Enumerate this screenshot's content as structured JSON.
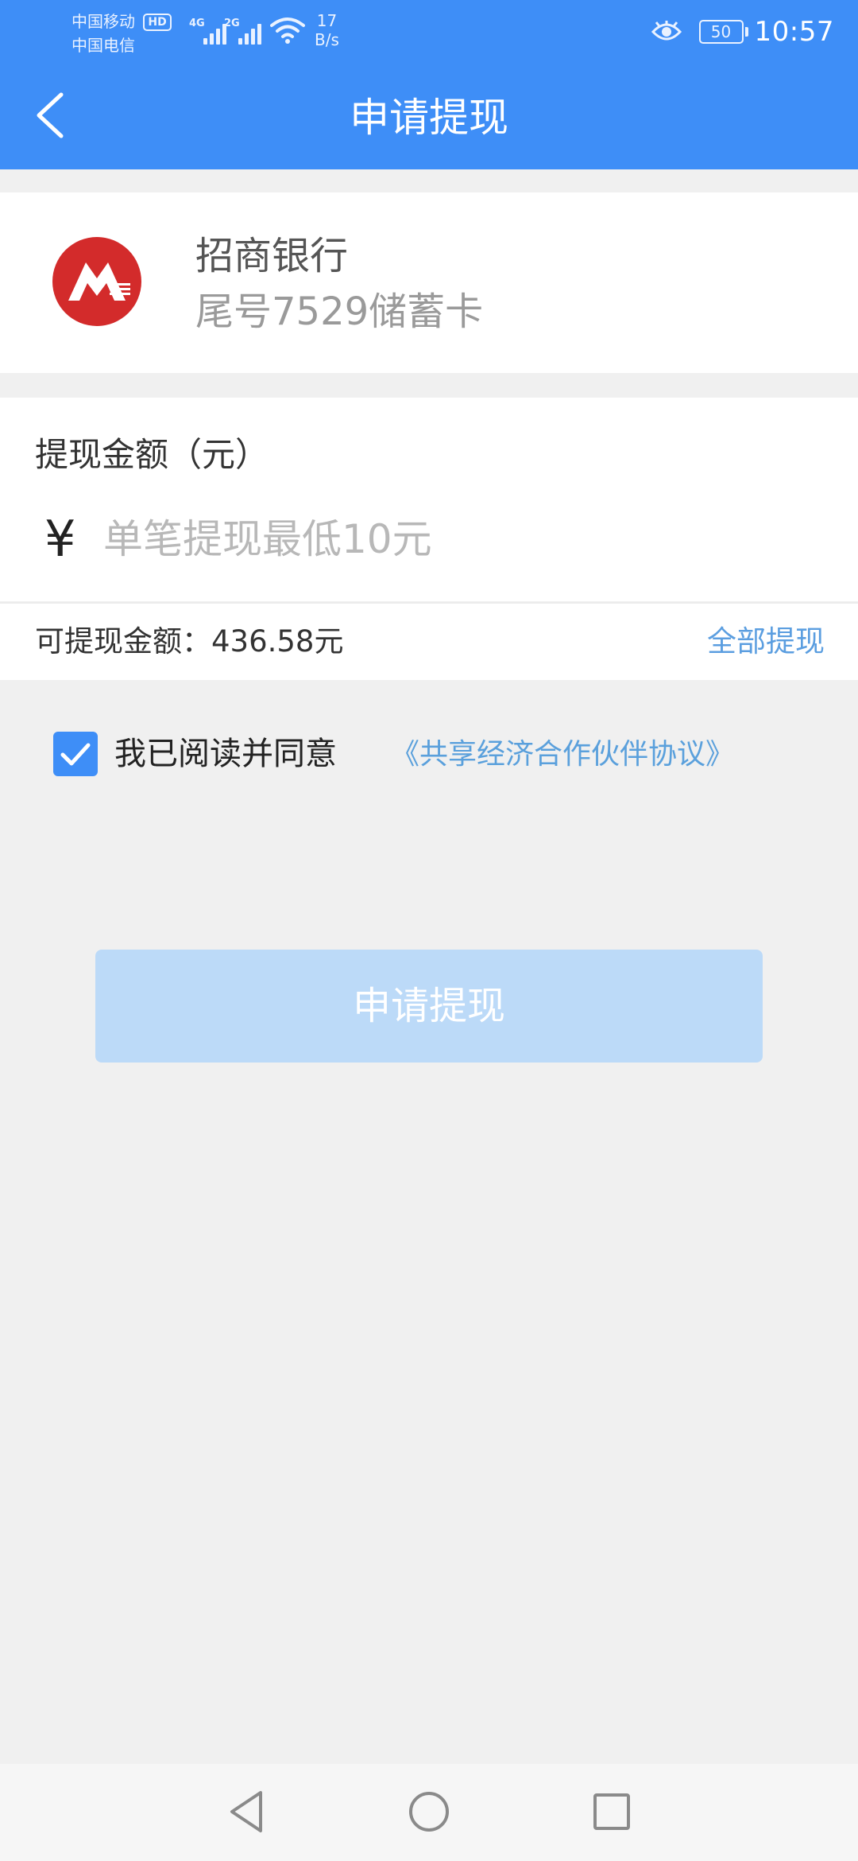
{
  "colors": {
    "primary": "#3e8ef7",
    "link": "#5aa0dc",
    "button_disabled": "#bcdaf8",
    "background": "#f0f0f0",
    "bank_logo_red": "#d32b2b"
  },
  "status_bar": {
    "carrier_1": "中国移动",
    "hd_badge": "HD",
    "carrier_2": "中国电信",
    "sim1_gen": "4G",
    "sim2_gen": "2G",
    "net_speed_value": "17",
    "net_speed_unit": "B/s",
    "battery": "50",
    "time": "10:57",
    "icons": [
      "signal-icon",
      "wifi-icon",
      "eye-icon",
      "battery-icon"
    ]
  },
  "header": {
    "title": "申请提现",
    "back_icon": "chevron-left-icon"
  },
  "bank_card": {
    "logo_icon": "cmb-bank-logo-icon",
    "bank_name": "招商银行",
    "card_desc": "尾号7529储蓄卡"
  },
  "amount": {
    "label": "提现金额（元）",
    "currency_symbol": "¥",
    "placeholder": "单笔提现最低10元",
    "value": ""
  },
  "available": {
    "label": "可提现金额：436.58元",
    "withdraw_all": "全部提现"
  },
  "agreement": {
    "checked": true,
    "text": "我已阅读并同意",
    "link": "《共享经济合作伙伴协议》"
  },
  "submit": {
    "label": "申请提现",
    "enabled": false
  },
  "nav_bar": {
    "buttons": [
      "back-triangle-icon",
      "home-circle-icon",
      "recents-square-icon"
    ]
  }
}
